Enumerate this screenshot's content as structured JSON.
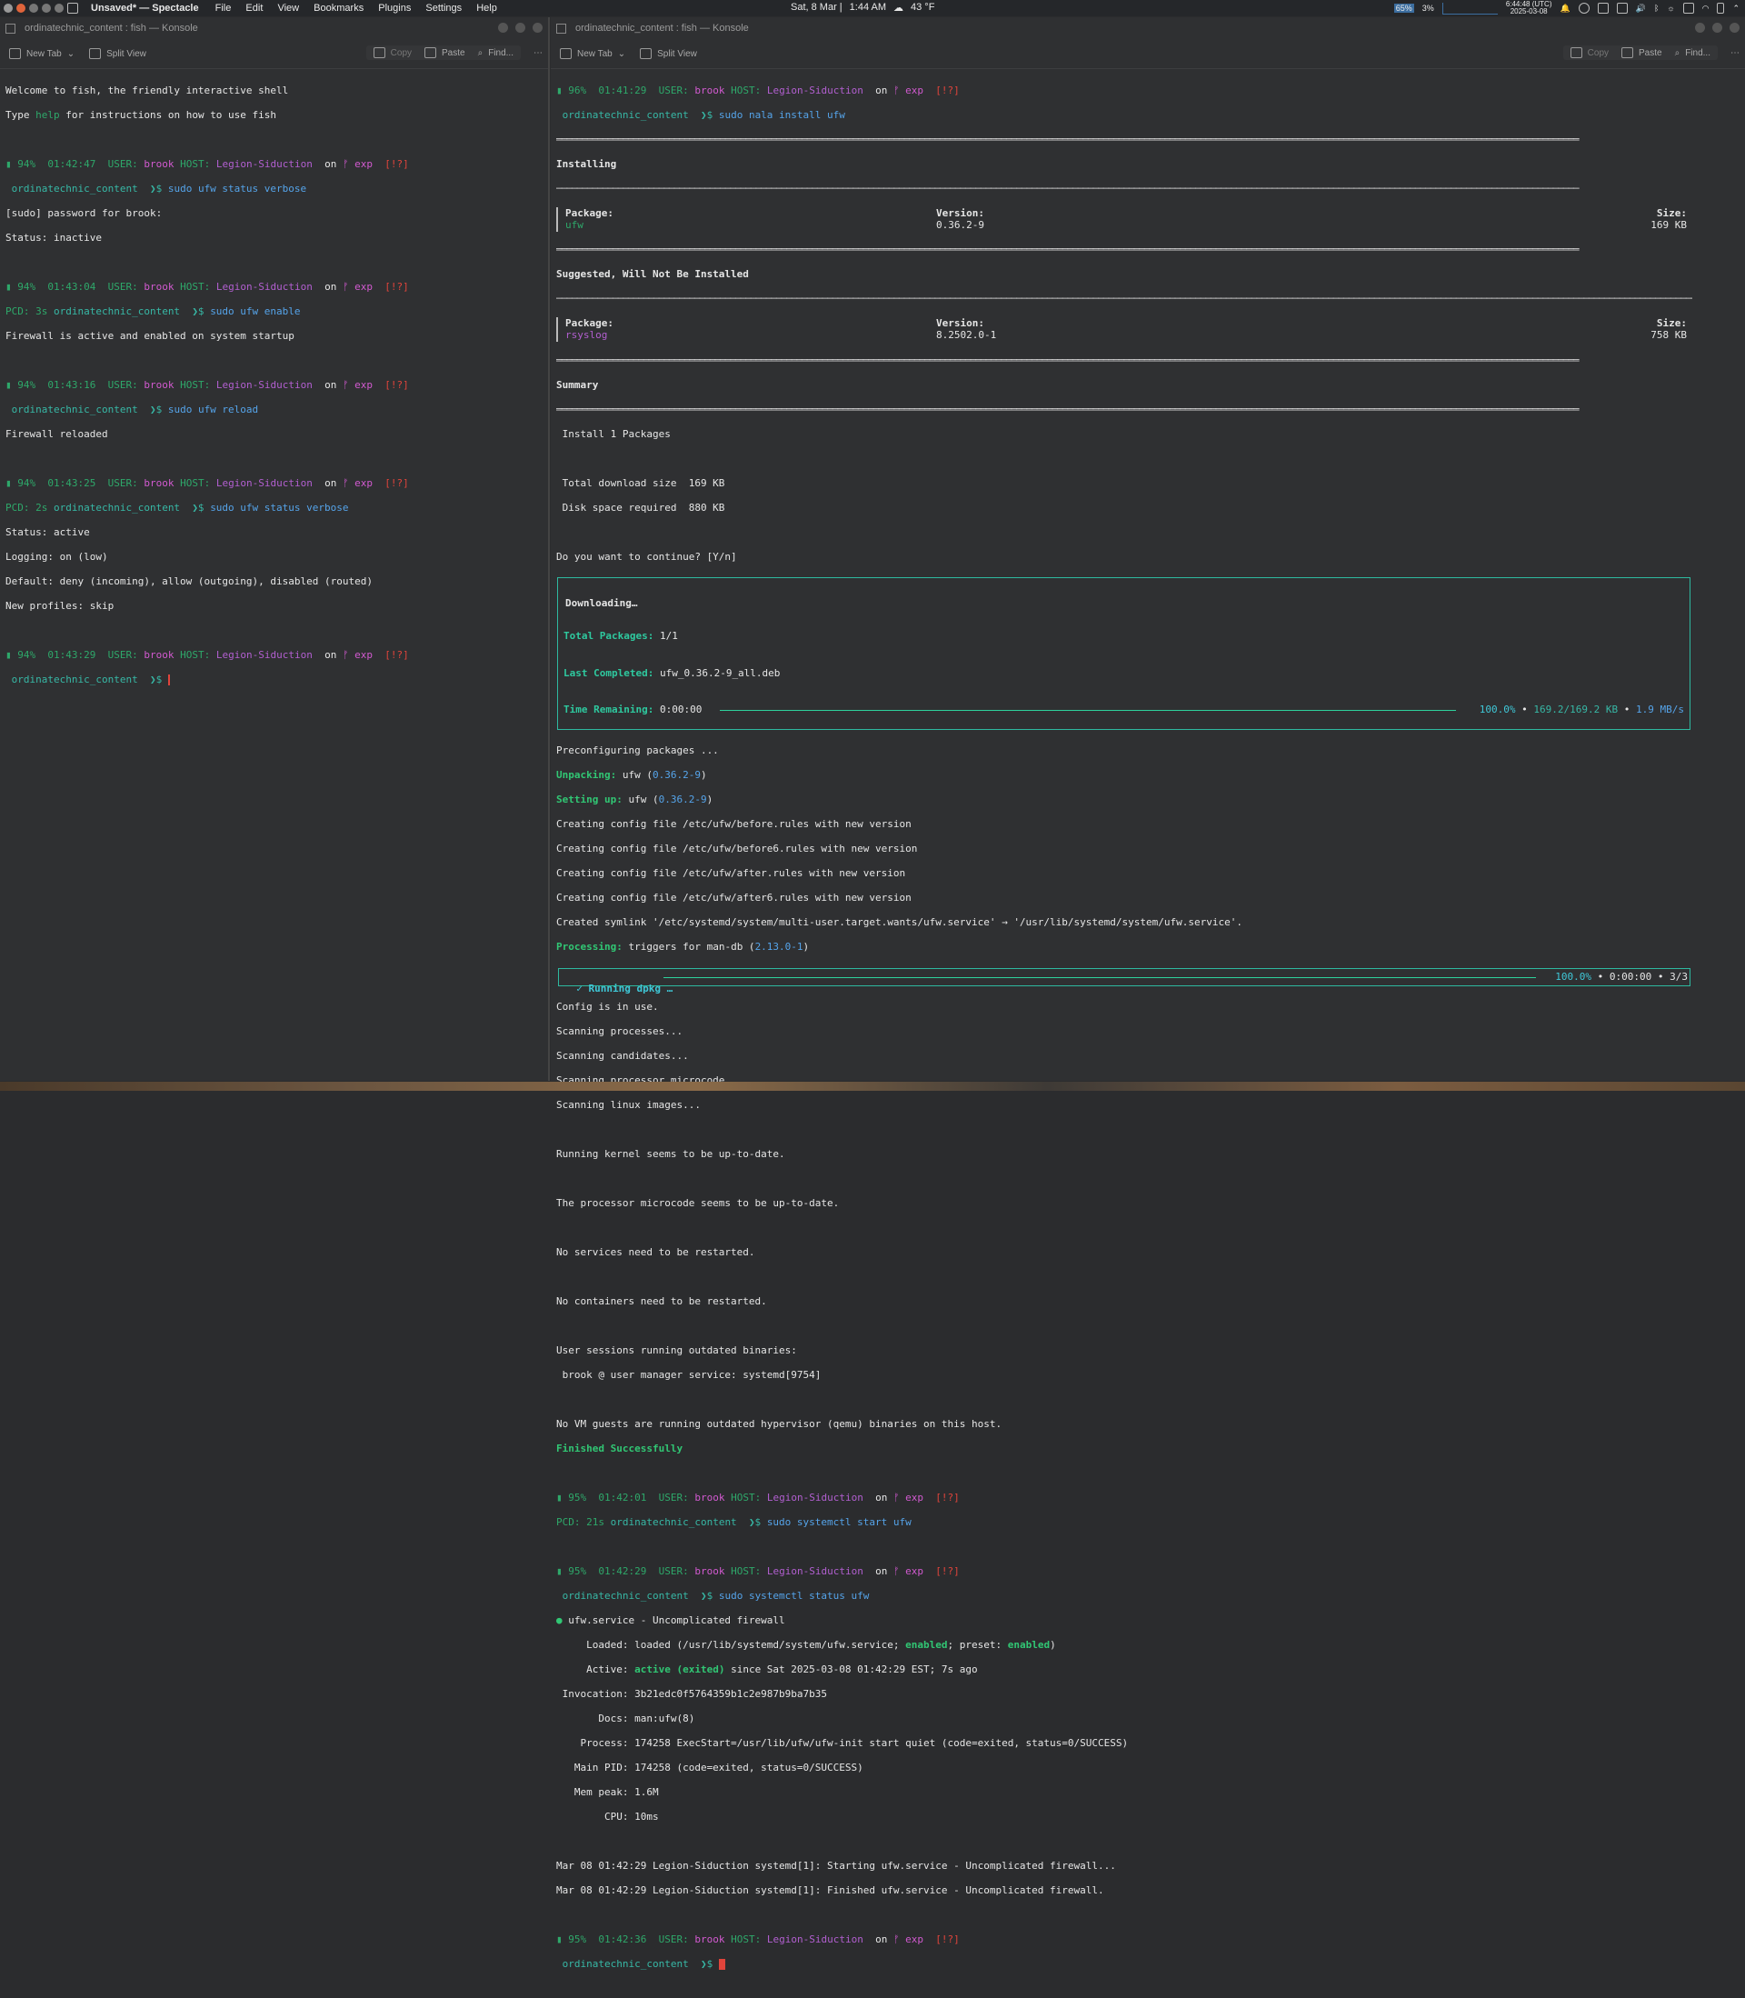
{
  "topbar": {
    "app_title": "Unsaved* — Spectacle",
    "menus": [
      "File",
      "Edit",
      "View",
      "Bookmarks",
      "Plugins",
      "Settings",
      "Help"
    ],
    "date": "Sat, 8 Mar |",
    "time": "1:44 AM",
    "weather": "43 °F",
    "cpu": "65%",
    "mem": "3%",
    "utc_time": "6:44:48 (UTC)",
    "utc_date": "2025-03-08"
  },
  "left": {
    "title": "ordinatechnic_content : fish — Konsole",
    "toolbar": {
      "new_tab": "New Tab",
      "split_view": "Split View",
      "copy": "Copy",
      "paste": "Paste",
      "find": "Find..."
    },
    "prompt": {
      "batt1": "94%",
      "user_lbl": "USER:",
      "user": "brook",
      "host_lbl": "HOST:",
      "host": "Legion-Siduction",
      "on": "on",
      "branch": "ᚠ exp",
      "status": "[!?]",
      "cwd": "ordinatechnic_content",
      "arrow": "❯$"
    },
    "welcome1": "Welcome to fish, the friendly interactive shell",
    "welcome2a": "Type ",
    "welcome2b": "help",
    "welcome2c": " for instructions on how to use fish",
    "b1": {
      "time": "01:42:47",
      "cmd": "sudo ufw status verbose",
      "out1": "[sudo] password for brook:",
      "out2": "Status: inactive"
    },
    "b2": {
      "time": "01:43:04",
      "pcd": "PCD: 3s",
      "cmd": "sudo ufw enable",
      "out1": "Firewall is active and enabled on system startup"
    },
    "b3": {
      "time": "01:43:16",
      "cmd": "sudo ufw reload",
      "out1": "Firewall reloaded"
    },
    "b4": {
      "time": "01:43:25",
      "pcd": "PCD: 2s",
      "cmd": "sudo ufw status verbose",
      "out1": "Status: active",
      "out2": "Logging: on (low)",
      "out3": "Default: deny (incoming), allow (outgoing), disabled (routed)",
      "out4": "New profiles: skip"
    },
    "b5": {
      "time": "01:43:29"
    }
  },
  "right": {
    "title": "ordinatechnic_content : fish — Konsole",
    "toolbar": {
      "new_tab": "New Tab",
      "split_view": "Split View",
      "copy": "Copy",
      "paste": "Paste",
      "find": "Find..."
    },
    "p1": {
      "batt": "96%",
      "time": "01:41:29",
      "cmd": "sudo nala install ufw"
    },
    "installing": "Installing",
    "col_package": "Package:",
    "col_version": "Version:",
    "col_size": "Size:",
    "inst_pkg": "ufw",
    "inst_ver": "0.36.2-9",
    "inst_size": "169 KB",
    "suggested": "Suggested, Will Not Be Installed",
    "sug_pkg": "rsyslog",
    "sug_ver": "8.2502.0-1",
    "sug_size": "758 KB",
    "summary": "Summary",
    "sum1": " Install 1 Packages",
    "sum2": " Total download size  169 KB",
    "sum3": " Disk space required  880 KB",
    "continue": "Do you want to continue? [Y/n]",
    "dl_title": "Downloading…",
    "dl_total_lbl": "Total Packages:",
    "dl_total": "1/1",
    "dl_last_lbl": "Last Completed:",
    "dl_last": "ufw_0.36.2-9_all.deb",
    "dl_rem_lbl": "Time Remaining:",
    "dl_rem": "0:00:00",
    "dl_pct": "100.0%",
    "dl_bytes": "169.2/169.2 KB",
    "dl_speed": "1.9 MB/s",
    "dl_progress": 1.0,
    "preconf": "Preconfiguring packages ...",
    "unpack_lbl": "Unpacking:",
    "unpack_pkg": " ufw (",
    "unpack_ver": "0.36.2-9",
    "setup_lbl": "Setting up:",
    "setup_pkg": " ufw (",
    "setup_ver": "0.36.2-9",
    "cfg1": "Creating config file /etc/ufw/before.rules with new version",
    "cfg2": "Creating config file /etc/ufw/before6.rules with new version",
    "cfg3": "Creating config file /etc/ufw/after.rules with new version",
    "cfg4": "Creating config file /etc/ufw/after6.rules with new version",
    "symlink": "Created symlink '/etc/systemd/system/multi-user.target.wants/ufw.service' → '/usr/lib/systemd/system/ufw.service'.",
    "proc_lbl": "Processing:",
    "proc_txt": " triggers for man-db (",
    "proc_ver": "2.13.0-1",
    "dpkg_lbl": "✓ Running dpkg …",
    "dpkg_pct": "100.0%",
    "dpkg_time": "0:00:00",
    "dpkg_count": "3/3",
    "dpkg_progress": 1.0,
    "scan1": "Config is in use.",
    "scan2": "Scanning processes...",
    "scan3": "Scanning candidates...",
    "scan4": "Scanning processor microcode...",
    "scan5": "Scanning linux images...",
    "kernel": "Running kernel seems to be up-to-date.",
    "microcode": "The processor microcode seems to be up-to-date.",
    "nosvc": "No services need to be restarted.",
    "nocont": "No containers need to be restarted.",
    "usess": "User sessions running outdated binaries:",
    "usess2": " brook @ user manager service: systemd[9754]",
    "novm": "No VM guests are running outdated hypervisor (qemu) binaries on this host.",
    "finished": "Finished Successfully",
    "p2": {
      "batt": "95%",
      "time": "01:42:01",
      "pcd": "PCD: 21s",
      "cmd": "sudo systemctl start ufw"
    },
    "p3": {
      "batt": "95%",
      "time": "01:42:29",
      "cmd": "sudo systemctl status ufw"
    },
    "svc_title": "ufw.service - Uncomplicated firewall",
    "loaded_lbl": "     Loaded:",
    "loaded_a": " loaded (/usr/lib/systemd/system/ufw.service; ",
    "loaded_en": "enabled",
    "loaded_b": "; preset: ",
    "loaded_en2": "enabled",
    "loaded_c": ")",
    "active_lbl": "     Active:",
    "active_val": " active (exited)",
    "active_rest": " since Sat 2025-03-08 01:42:29 EST; 7s ago",
    "invocation": " Invocation: 3b21edc0f5764359b1c2e987b9ba7b35",
    "docs": "       Docs: man:ufw(8)",
    "process": "    Process: 174258 ExecStart=/usr/lib/ufw/ufw-init start quiet (code=exited, status=0/SUCCESS)",
    "mainpid": "   Main PID: 174258 (code=exited, status=0/SUCCESS)",
    "mempeak": "   Mem peak: 1.6M",
    "cpu": "        CPU: 10ms",
    "log1": "Mar 08 01:42:29 Legion-Siduction systemd[1]: Starting ufw.service - Uncomplicated firewall...",
    "log2": "Mar 08 01:42:29 Legion-Siduction systemd[1]: Finished ufw.service - Uncomplicated firewall.",
    "p4": {
      "batt": "95%",
      "time": "01:42:36"
    }
  },
  "colors": {
    "green": "#2ea86a",
    "cyan": "#37b8a6",
    "magenta": "#b25fd0",
    "red": "#e0443b",
    "blue": "#55a4ea"
  }
}
